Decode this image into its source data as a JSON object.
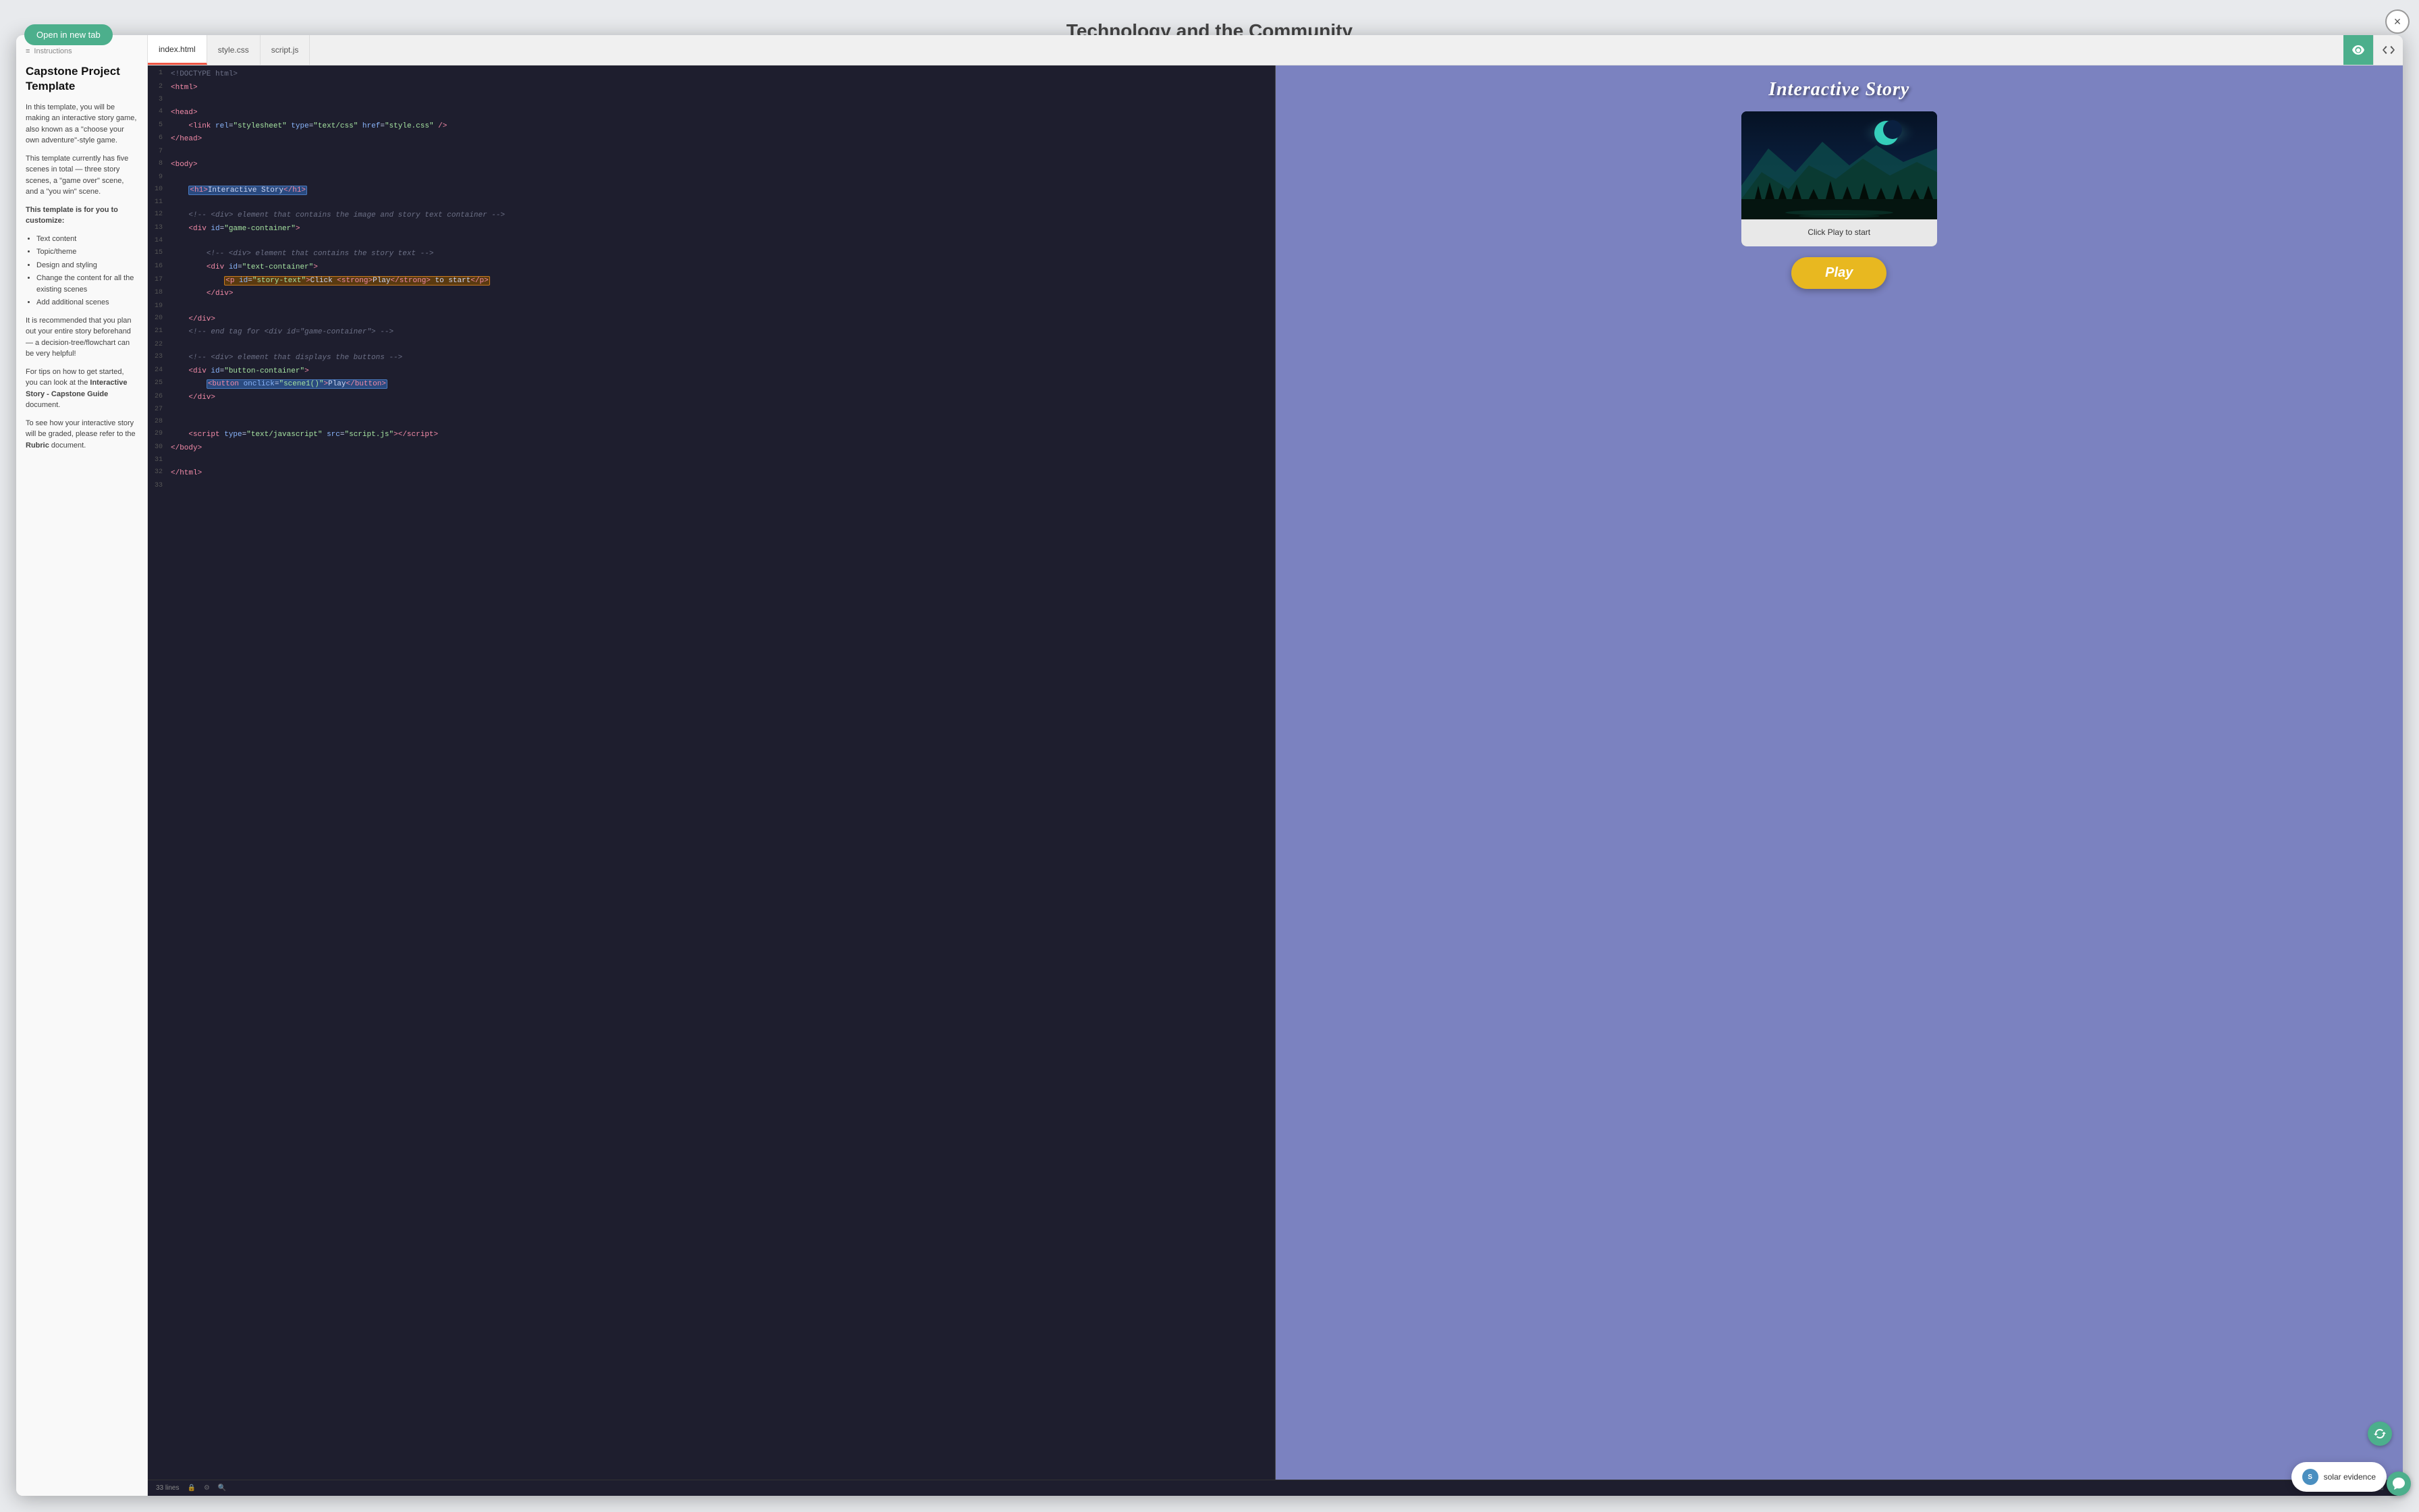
{
  "page": {
    "bg_title": "Technology and the Community",
    "close_btn_label": "×"
  },
  "open_new_tab": {
    "label": "Open in new tab"
  },
  "instructions": {
    "header_label": "Instructions",
    "title": "Capstone Project Template",
    "para1": "In this template, you will be making an interactive story game, also known as a \"choose your own adventure\"-style game.",
    "para2": "This template currently has five scenes in total — three story scenes, a \"game over\" scene, and a \"you win\" scene.",
    "customize_label": "This template is for you to customize:",
    "list_items": [
      "Text content",
      "Topic/theme",
      "Design and styling",
      "Change the content for all the existing scenes",
      "Add additional scenes"
    ],
    "para3": "It is recommended that you plan out your entire story beforehand — a decision-tree/flowchart can be very helpful!",
    "para4_prefix": "For tips on how to get started, you can look at the ",
    "para4_link": "Interactive Story - Capstone Guide",
    "para4_suffix": " document.",
    "para5_prefix": "To see how your interactive story will be graded, please refer to the ",
    "para5_link": "Rubric",
    "para5_suffix": " document."
  },
  "tabs": [
    {
      "id": "index-html",
      "label": "index.html",
      "active": true
    },
    {
      "id": "style-css",
      "label": "style.css",
      "active": false
    },
    {
      "id": "script-js",
      "label": "script.js",
      "active": false
    }
  ],
  "code_editor": {
    "lines_label": "33 lines"
  },
  "preview": {
    "title": "Interactive Story",
    "story_text": "Click Play to start",
    "play_btn_label": "Play"
  },
  "chat_widget": {
    "label": "solar evidence",
    "avatar_letter": "S"
  }
}
